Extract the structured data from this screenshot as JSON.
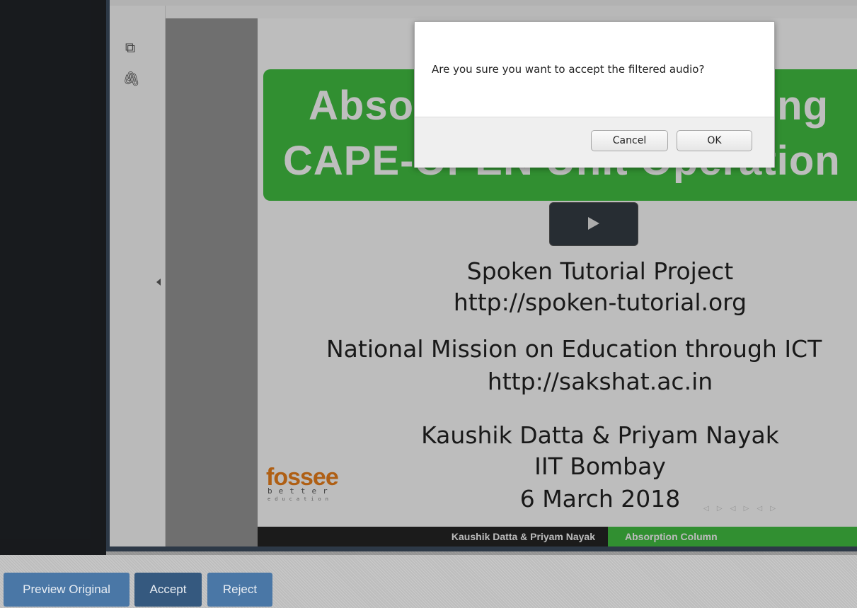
{
  "slide": {
    "title_line1": "Absorption Column using",
    "title_line2": "CAPE-OPEN Unit Operation",
    "project": "Spoken Tutorial Project",
    "project_url": "http://spoken-tutorial.org",
    "mission": "National Mission on Education through ICT",
    "mission_url": "http://sakshat.ac.in",
    "authors": "Kaushik Datta & Priyam Nayak",
    "institute": "IIT Bombay",
    "date": "6 March 2018",
    "logo_word": "fossee",
    "logo_sub": "better",
    "logo_sub2": "education",
    "footer_authors": "Kaushik Datta & Priyam Nayak",
    "footer_topic": "Absorption Column"
  },
  "sidebar": {
    "icons": [
      "copy-pages-icon",
      "paperclip-icon"
    ]
  },
  "dialog": {
    "message": "Are you sure you want to accept the filtered audio?",
    "cancel_label": "Cancel",
    "ok_label": "OK"
  },
  "actions": {
    "preview_label": "Preview Original",
    "accept_label": "Accept",
    "reject_label": "Reject"
  },
  "colors": {
    "slide_green": "#3fb83f",
    "action_blue": "#4a77a6",
    "accept_blue": "#35597f"
  }
}
